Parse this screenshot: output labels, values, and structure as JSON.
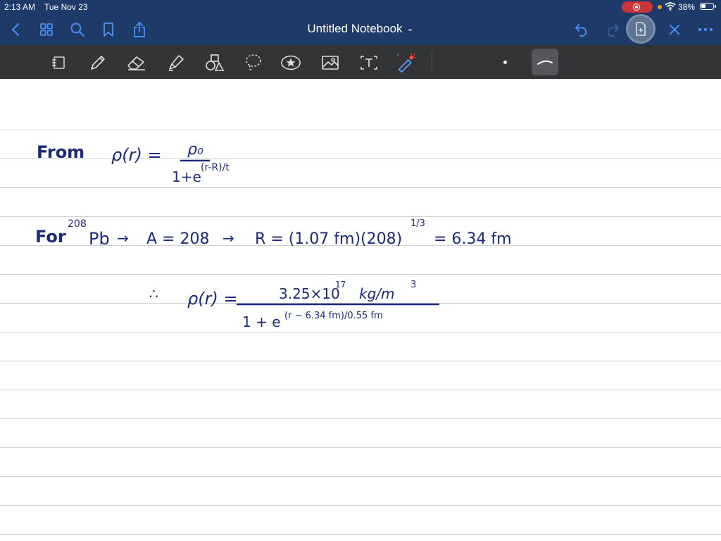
{
  "status_bar": {
    "time": "2:13 AM",
    "date": "Tue Nov 23",
    "battery_percent": "38%",
    "battery_level": 0.38,
    "recording_color": "#c9343c"
  },
  "nav_bar": {
    "title": "Untitled Notebook",
    "title_caret": "⌄",
    "icons": {
      "back": "chevron-left-icon",
      "grid": "thumbnails-grid-icon",
      "search": "search-icon",
      "bookmark": "bookmark-icon",
      "share": "share-icon",
      "undo": "undo-icon",
      "redo": "redo-icon",
      "add_page": "add-page-icon",
      "close": "close-icon",
      "more": "more-icon"
    },
    "background_color": "#1d3a68",
    "accent_color": "#4a8cf0"
  },
  "toolbar": {
    "tools": [
      "read-only-mode-icon",
      "pen-icon",
      "eraser-icon",
      "highlighter-icon",
      "shapes-icon",
      "lasso-icon",
      "stickers-icon",
      "image-icon",
      "text-icon",
      "laser-pointer-icon"
    ],
    "background_color": "#333436"
  },
  "notes": {
    "line1": {
      "label": "From",
      "lhs": "ρ(r) =",
      "numerator": "ρ₀",
      "denominator": "1+e",
      "exponent": "(r-R)/t"
    },
    "line2": {
      "label": "For",
      "mass_number": "208",
      "element": "Pb",
      "arrow1": "→",
      "a_equals": "A = 208",
      "arrow2": "→",
      "r_equals": "R = (1.07 fm)(208)",
      "power": "1/3",
      "result": "= 6.34 fm"
    },
    "line3": {
      "therefore": "∴",
      "lhs": "ρ(r) =",
      "numerator": "3.25×10",
      "numerator_power": "17",
      "numerator_unit": "kg/m",
      "unit_power": "3",
      "denominator": "1 + e",
      "exponent": "(r − 6.34 fm)/0.55 fm"
    },
    "ink_color": "#1c2a7a"
  }
}
